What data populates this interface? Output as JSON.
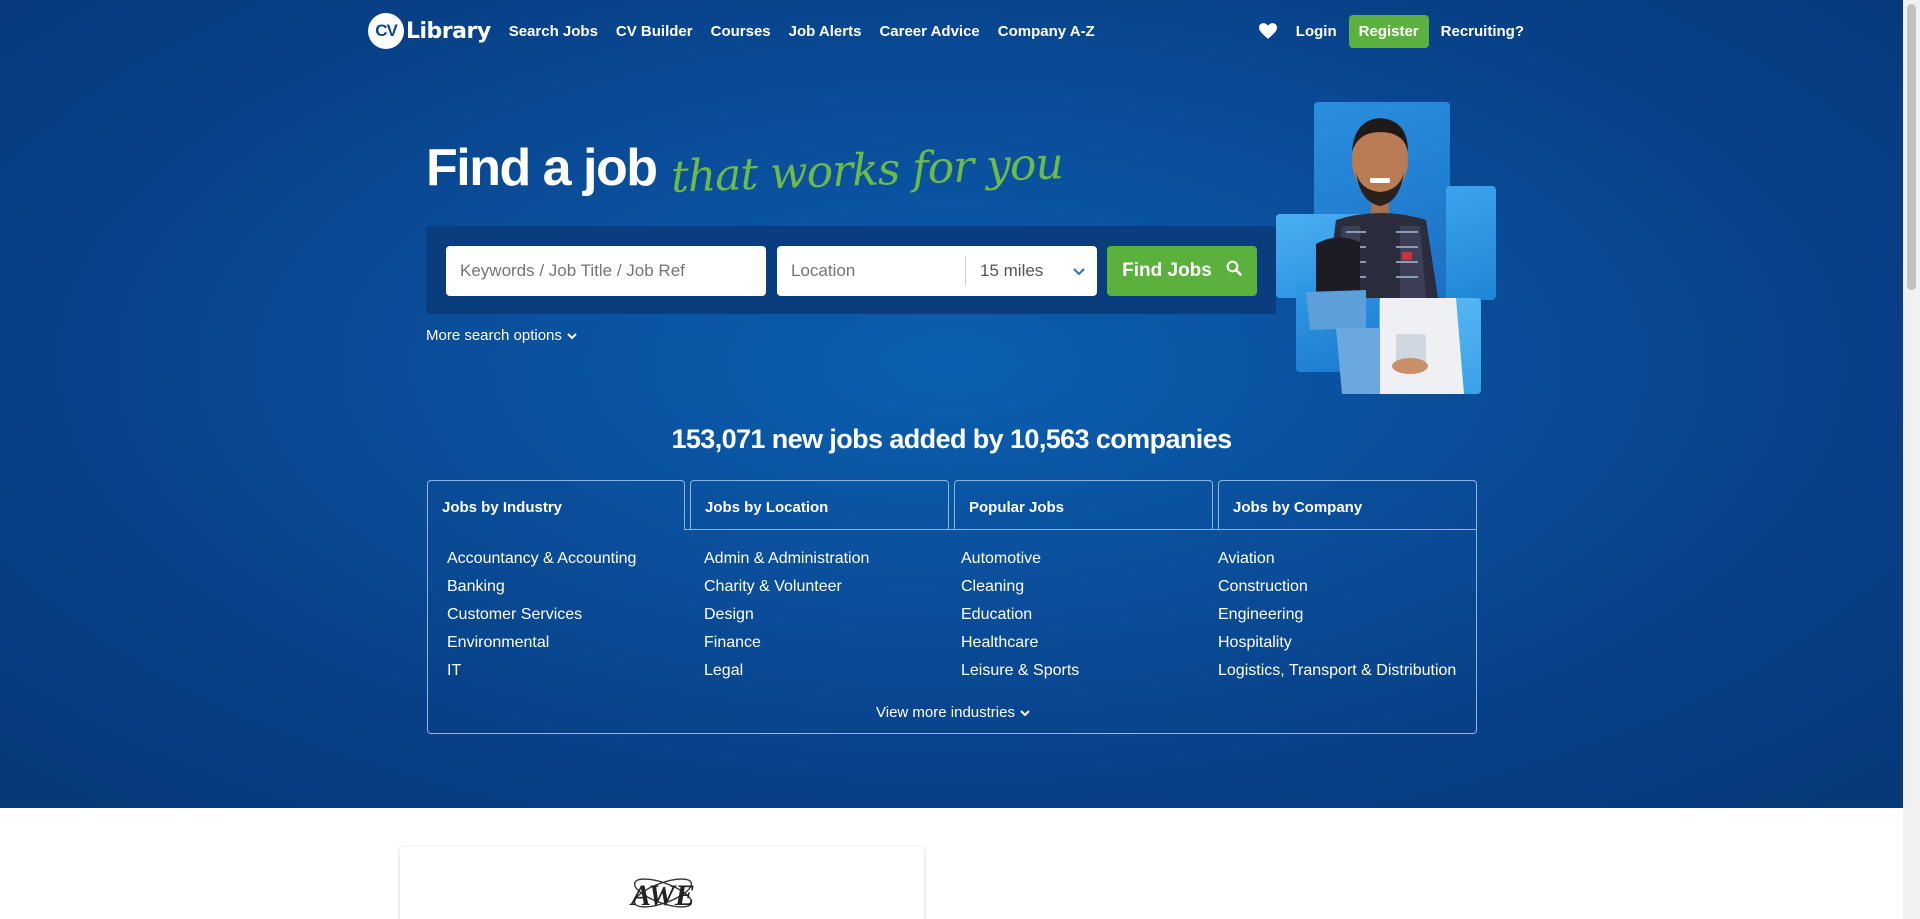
{
  "header": {
    "logo": {
      "badge": "CV",
      "text": "Library"
    },
    "nav": [
      {
        "label": "Search Jobs"
      },
      {
        "label": "CV Builder"
      },
      {
        "label": "Courses"
      },
      {
        "label": "Job Alerts"
      },
      {
        "label": "Career Advice"
      },
      {
        "label": "Company A-Z"
      }
    ],
    "favourites_icon": "heart-icon",
    "login_label": "Login",
    "register_label": "Register",
    "recruiting_label": "Recruiting?"
  },
  "hero": {
    "headline_main": "Find a job",
    "headline_script": "that works for you",
    "search": {
      "keywords_placeholder": "Keywords / Job Title / Job Ref",
      "location_placeholder": "Location",
      "radius_value": "15 miles",
      "find_label": "Find Jobs",
      "more_options_label": "More search options"
    },
    "stats": "153,071 new jobs added by 10,563 companies"
  },
  "browse": {
    "tabs": [
      {
        "label": "Jobs by Industry",
        "active": true
      },
      {
        "label": "Jobs by Location",
        "active": false
      },
      {
        "label": "Popular Jobs",
        "active": false
      },
      {
        "label": "Jobs by Company",
        "active": false
      }
    ],
    "columns": [
      [
        "Accountancy & Accounting",
        "Banking",
        "Customer Services",
        "Environmental",
        "IT"
      ],
      [
        "Admin & Administration",
        "Charity & Volunteer",
        "Design",
        "Finance",
        "Legal"
      ],
      [
        "Automotive",
        "Cleaning",
        "Education",
        "Healthcare",
        "Leisure & Sports"
      ],
      [
        "Aviation",
        "Construction",
        "Engineering",
        "Hospitality",
        "Logistics, Transport & Distribution"
      ]
    ],
    "view_more_label": "View more industries"
  },
  "featured": {
    "logo_text": "AWE"
  },
  "colors": {
    "brand_blue": "#0a4f9c",
    "panel_blue": "#0a3d7d",
    "accent_green": "#5bb03e"
  }
}
